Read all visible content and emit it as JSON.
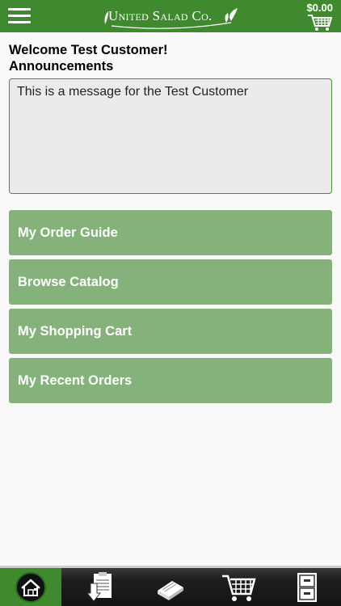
{
  "header": {
    "logo_text": "United Salad Co.",
    "cart_total": "$0.00"
  },
  "main": {
    "welcome": "Welcome Test Customer!",
    "announcements_title": "Announcements",
    "announcement_message": "This is a message for the Test Customer"
  },
  "menu": [
    {
      "label": "My Order Guide"
    },
    {
      "label": "Browse Catalog"
    },
    {
      "label": "My Shopping Cart"
    },
    {
      "label": "My Recent Orders"
    }
  ],
  "tabbar": {
    "tabs": [
      {
        "icon": "home-icon"
      },
      {
        "icon": "clipboard-download-icon"
      },
      {
        "icon": "catalog-book-icon"
      },
      {
        "icon": "shopping-cart-icon"
      },
      {
        "icon": "file-cabinet-icon"
      }
    ]
  },
  "colors": {
    "brand_green": "#3f8a2e",
    "button_green": "#84b27a",
    "tabbar_dark": "#1e1e1e"
  }
}
